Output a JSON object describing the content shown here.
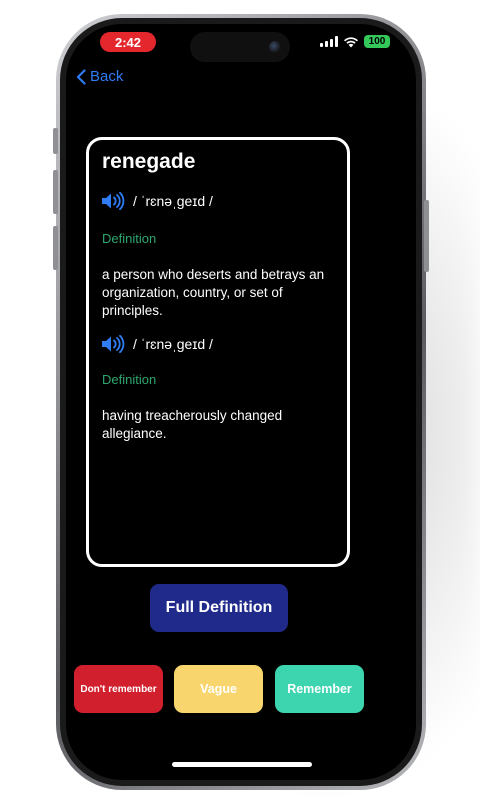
{
  "status_bar": {
    "time": "2:42",
    "battery": "100"
  },
  "nav": {
    "back_label": "Back"
  },
  "word": {
    "title": "renegade",
    "entries": [
      {
        "pronunciation": "/ ˈrɛnəˌɡeɪd /",
        "definition_label": "Definition",
        "definition": "a person who deserts and betrays an organization, country, or set of principles."
      },
      {
        "pronunciation": "/ ˈrɛnəˌɡeɪd /",
        "definition_label": "Definition",
        "definition": "having treacherously changed allegiance."
      }
    ]
  },
  "actions": {
    "full_definition": "Full Definition",
    "dont_remember": "Don't remember",
    "vague": "Vague",
    "remember": "Remember"
  },
  "colors": {
    "accent_blue": "#2f7cf6",
    "definition_green": "#2ea66d",
    "dont_remember_red": "#d21f2d",
    "vague_yellow": "#f8d66d",
    "remember_teal": "#3dd4b0",
    "full_definition_navy": "#1f2a8a",
    "time_pill_red": "#e3272d",
    "battery_green": "#34c759"
  }
}
